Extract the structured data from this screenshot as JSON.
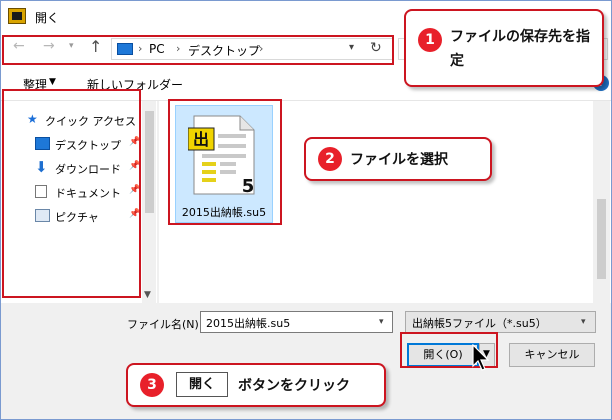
{
  "window": {
    "title": "開く"
  },
  "address": {
    "crumbs": [
      "PC",
      "デスクトップ"
    ]
  },
  "toolbar": {
    "organize_label": "整理",
    "new_folder_label": "新しいフォルダー"
  },
  "navpane": {
    "quick_access": "クイック アクセス",
    "items": [
      {
        "label": "デスクトップ",
        "icon": "desktop-icon"
      },
      {
        "label": "ダウンロード",
        "icon": "download-arrow-icon"
      },
      {
        "label": "ドキュメント",
        "icon": "document-icon"
      },
      {
        "label": "ピクチャ",
        "icon": "picture-icon"
      }
    ]
  },
  "content": {
    "files": [
      {
        "name": "2015出納帳.su5",
        "icon_badge": "出",
        "icon_digit": "5"
      }
    ]
  },
  "bottom": {
    "filename_label": "ファイル名(N):",
    "filename_value": "2015出納帳.su5",
    "filetype_value": "出納帳5ファイル（*.su5）",
    "open_label": "開く(O)",
    "cancel_label": "キャンセル"
  },
  "callouts": [
    {
      "num": "1",
      "text": "ファイルの保存先を指定"
    },
    {
      "num": "2",
      "text": "ファイルを選択"
    },
    {
      "num": "3",
      "key": "開く",
      "text": "ボタンをクリック"
    }
  ],
  "colors": {
    "callout_red": "#cc1520",
    "badge_red": "#e8202a",
    "selection": "#cce8ff",
    "accent": "#0078d7"
  }
}
